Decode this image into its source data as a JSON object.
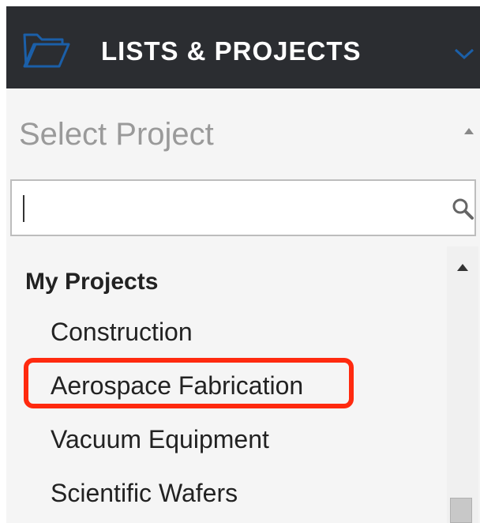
{
  "header": {
    "title": "LISTS & PROJECTS",
    "icon": "folder-icon",
    "collapse_icon": "chevron-down-icon"
  },
  "project_select": {
    "placeholder": "Select Project",
    "arrow_icon": "chevron-up-icon"
  },
  "search": {
    "value": "",
    "icon": "search-icon"
  },
  "project_list": {
    "group_label": "My Projects",
    "items": [
      {
        "label": "Construction"
      },
      {
        "label": "Aerospace Fabrication",
        "highlighted": true
      },
      {
        "label": "Vacuum Equipment"
      },
      {
        "label": "Scientific Wafers"
      }
    ]
  },
  "colors": {
    "header_bg": "#2b2d31",
    "header_text": "#ffffff",
    "highlight_border": "#ff2a0f",
    "panel_bg": "#f5f5f5"
  }
}
